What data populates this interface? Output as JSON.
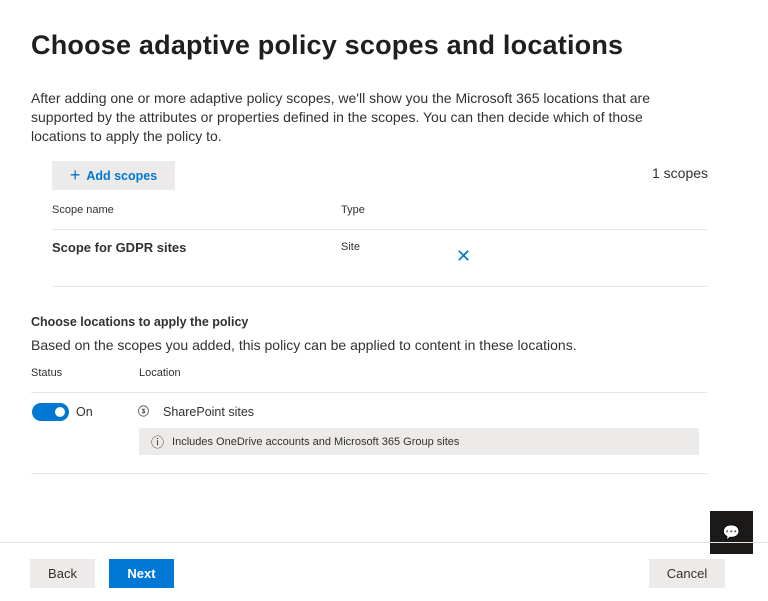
{
  "title": "Choose adaptive policy scopes and locations",
  "description": "After adding one or more adaptive policy scopes, we'll show you the Microsoft 365 locations that are supported by the attributes or properties defined in the scopes. You can then decide which of those locations to apply the policy to.",
  "add_scopes": "Add scopes",
  "scope_count": "1 scopes",
  "scope_table": {
    "headers": [
      "Scope name",
      "Type"
    ],
    "rows": [
      {
        "name": "Scope for GDPR sites",
        "type": "Site"
      }
    ]
  },
  "locations": {
    "heading": "Choose locations to apply the policy",
    "subheading": "Based on the scopes you added, this policy can be applied to content in these locations.",
    "headers": [
      "Status",
      "Location"
    ],
    "rows": [
      {
        "status": "On",
        "location": "SharePoint sites",
        "info": "Includes OneDrive accounts and Microsoft 365 Group sites"
      }
    ]
  },
  "footer": {
    "back": "Back",
    "next": "Next",
    "cancel": "Cancel"
  }
}
